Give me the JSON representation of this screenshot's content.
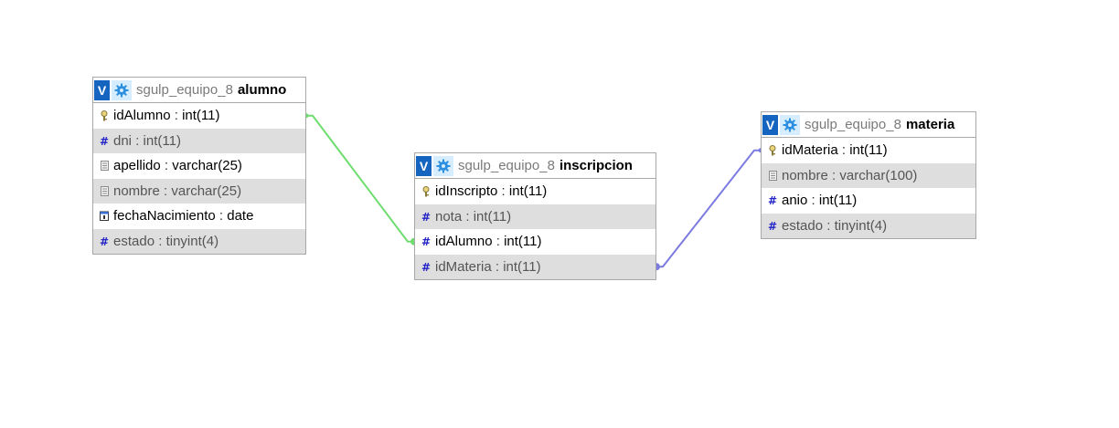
{
  "tables": [
    {
      "id": "alumno",
      "db": "sgulp_equipo_8",
      "name": "alumno",
      "toggle": "V",
      "columns": [
        {
          "name": "idAlumno",
          "type": "int(11)",
          "icon": "key-icon",
          "muted": false
        },
        {
          "name": "dni",
          "type": "int(11)",
          "icon": "hash-icon",
          "muted": true
        },
        {
          "name": "apellido",
          "type": "varchar(25)",
          "icon": "text-icon",
          "muted": false
        },
        {
          "name": "nombre",
          "type": "varchar(25)",
          "icon": "text-icon",
          "muted": true
        },
        {
          "name": "fechaNacimiento",
          "type": "date",
          "icon": "date-icon",
          "muted": false
        },
        {
          "name": "estado",
          "type": "tinyint(4)",
          "icon": "hash-icon",
          "muted": true
        }
      ]
    },
    {
      "id": "inscripcion",
      "db": "sgulp_equipo_8",
      "name": "inscripcion",
      "toggle": "V",
      "columns": [
        {
          "name": "idInscripto",
          "type": "int(11)",
          "icon": "key-icon",
          "muted": false
        },
        {
          "name": "nota",
          "type": "int(11)",
          "icon": "hash-icon",
          "muted": true
        },
        {
          "name": "idAlumno",
          "type": "int(11)",
          "icon": "hash-icon",
          "muted": false
        },
        {
          "name": "idMateria",
          "type": "int(11)",
          "icon": "hash-icon",
          "muted": true
        }
      ]
    },
    {
      "id": "materia",
      "db": "sgulp_equipo_8",
      "name": "materia",
      "toggle": "V",
      "columns": [
        {
          "name": "idMateria",
          "type": "int(11)",
          "icon": "key-icon",
          "muted": false
        },
        {
          "name": "nombre",
          "type": "varchar(100)",
          "icon": "text-icon",
          "muted": true
        },
        {
          "name": "anio",
          "type": "int(11)",
          "icon": "hash-icon",
          "muted": false
        },
        {
          "name": "estado",
          "type": "tinyint(4)",
          "icon": "hash-icon",
          "muted": true
        }
      ]
    }
  ],
  "relations": [
    {
      "from_table": "alumno",
      "from_column": "idAlumno",
      "to_table": "inscripcion",
      "to_column": "idAlumno",
      "color": "#6fdc6f"
    },
    {
      "from_table": "materia",
      "from_column": "idMateria",
      "to_table": "inscripcion",
      "to_column": "idMateria",
      "color": "#7b7be0"
    }
  ],
  "colors": {
    "toggle_bg": "#1565c0",
    "gear_bg": "#d6ecff",
    "gear": "#2d8fe0",
    "alt_row": "#dedede",
    "border": "#a8a8a8",
    "hash": "#2323c8",
    "key": "#8a7a3a"
  }
}
